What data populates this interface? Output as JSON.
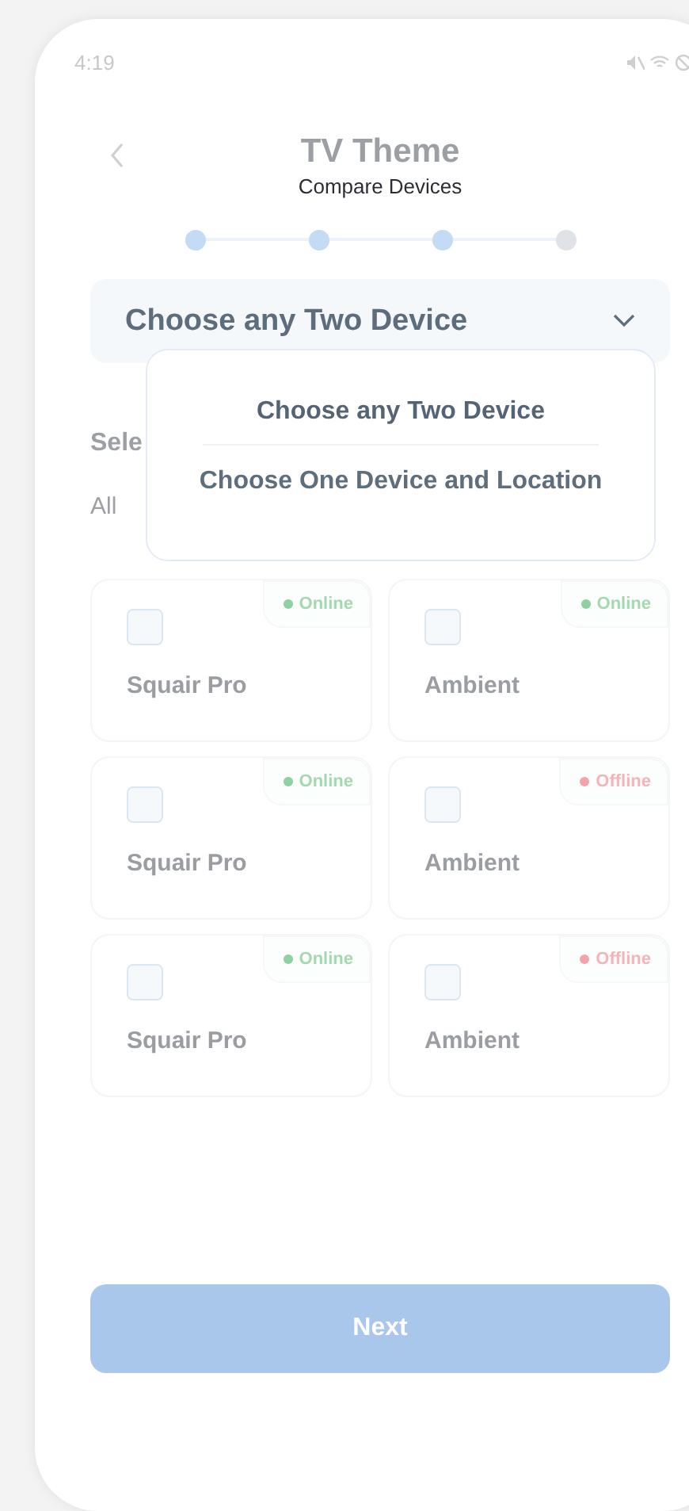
{
  "status_bar": {
    "time": "4:19"
  },
  "header": {
    "title": "TV Theme",
    "subtitle": "Compare Devices"
  },
  "steps": [
    {
      "done": true
    },
    {
      "done": true
    },
    {
      "done": true
    },
    {
      "done": false
    }
  ],
  "mode_select": {
    "value": "Choose any Two Device",
    "expanded": true,
    "options": [
      {
        "label": "Choose any Two Device",
        "selected": true
      },
      {
        "label": "Choose One Device and Location",
        "selected": false
      }
    ]
  },
  "section_label": "Sele",
  "filter_label": "All",
  "devices": [
    {
      "name": "Squair Pro",
      "checked": false,
      "status": "Online",
      "color": "#8fd19e"
    },
    {
      "name": "Ambient",
      "checked": false,
      "status": "Online",
      "color": "#8fd19e"
    },
    {
      "name": "Squair Pro",
      "checked": false,
      "status": "Online",
      "color": "#8fd19e"
    },
    {
      "name": "Ambient",
      "checked": false,
      "status": "Offline",
      "color": "#f4a3a8"
    },
    {
      "name": "Squair Pro",
      "checked": false,
      "status": "Online",
      "color": "#8fd19e"
    },
    {
      "name": "Ambient",
      "checked": false,
      "status": "Offline",
      "color": "#f4a3a8"
    }
  ],
  "next_button": {
    "label": "Next",
    "disabled": true
  }
}
